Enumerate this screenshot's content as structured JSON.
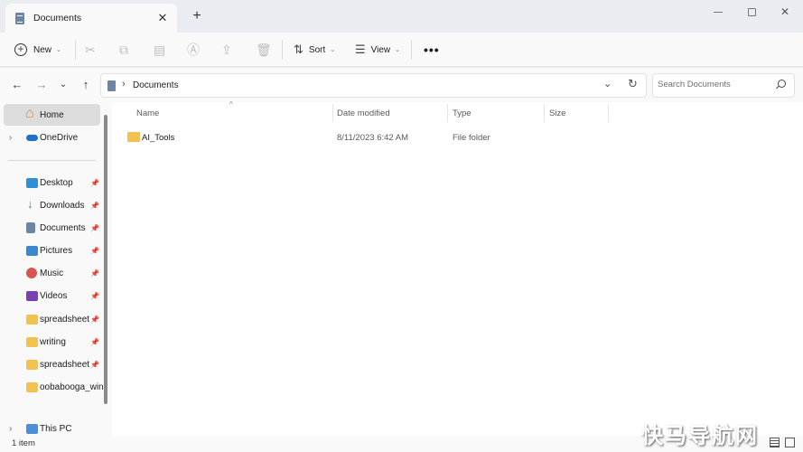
{
  "window": {
    "tab_title": "Documents",
    "tab_close": "✕",
    "new_tab": "+"
  },
  "toolbar": {
    "new_label": "New",
    "sort_label": "Sort",
    "view_label": "View",
    "more_label": "•••"
  },
  "address": {
    "crumb": "Documents",
    "search_placeholder": "Search Documents"
  },
  "sidebar": {
    "home": "Home",
    "onedrive": "OneDrive",
    "items": [
      {
        "label": "Desktop",
        "icon": "desktop-icon"
      },
      {
        "label": "Downloads",
        "icon": "downloads-icon"
      },
      {
        "label": "Documents",
        "icon": "documents-icon"
      },
      {
        "label": "Pictures",
        "icon": "pictures-icon"
      },
      {
        "label": "Music",
        "icon": "music-icon"
      },
      {
        "label": "Videos",
        "icon": "videos-icon"
      },
      {
        "label": "spreadsheet",
        "icon": "folder-icon"
      },
      {
        "label": "writing",
        "icon": "folder-icon"
      },
      {
        "label": "spreadsheet",
        "icon": "folder-icon"
      },
      {
        "label": "oobabooga_win",
        "icon": "folder-icon"
      }
    ],
    "this_pc": "This PC"
  },
  "columns": {
    "name": "Name",
    "date": "Date modified",
    "type": "Type",
    "size": "Size"
  },
  "files": [
    {
      "name": "AI_Tools",
      "date": "8/11/2023 6:42 AM",
      "type": "File folder",
      "size": ""
    }
  ],
  "status": {
    "count": "1 item"
  },
  "watermark": "快马导航网",
  "colors": {
    "accent": "#1e6fd0",
    "folder": "#f2c24f",
    "selected_bg": "#dcdcdc"
  }
}
